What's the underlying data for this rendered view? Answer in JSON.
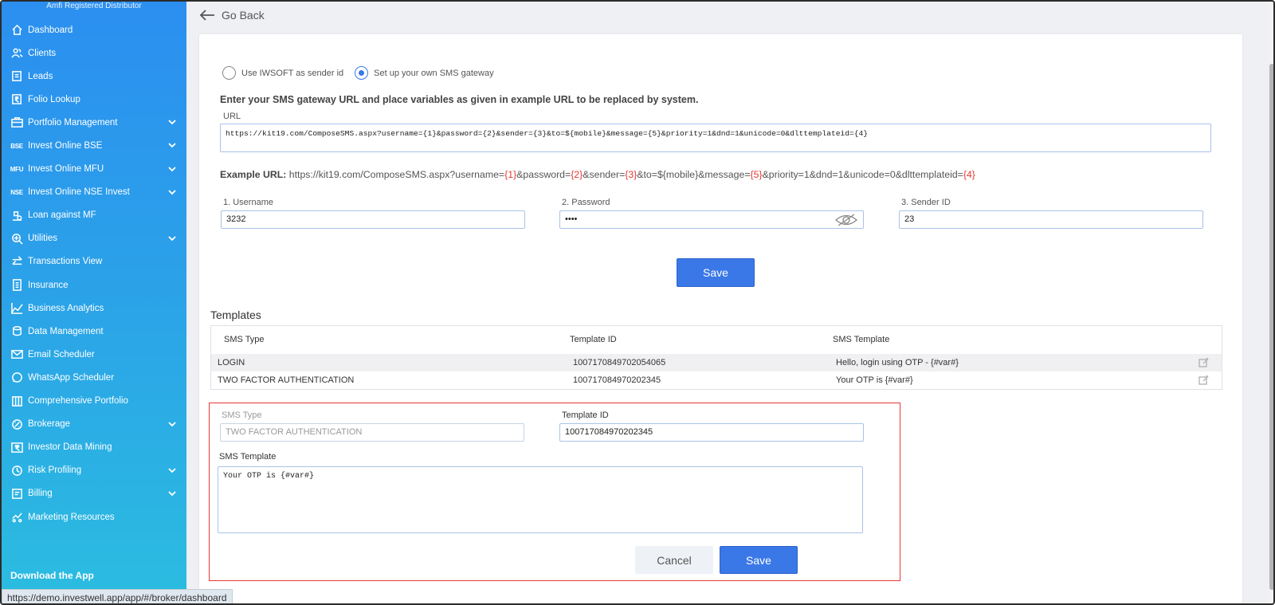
{
  "sidebar": {
    "brand": "Amfi Registered Distributor",
    "items": [
      {
        "label": "Dashboard",
        "icon": "home-icon",
        "chevron": false
      },
      {
        "label": "Clients",
        "icon": "users-icon",
        "chevron": false
      },
      {
        "label": "Leads",
        "icon": "leads-icon",
        "chevron": false
      },
      {
        "label": "Folio Lookup",
        "icon": "rupee-doc-icon",
        "chevron": false
      },
      {
        "label": "Portfolio Management",
        "icon": "briefcase-icon",
        "chevron": true
      },
      {
        "label": "Invest Online BSE",
        "icon": "bse-icon",
        "icon_text": "BSE",
        "chevron": true
      },
      {
        "label": "Invest Online MFU",
        "icon": "mfu-icon",
        "icon_text": "MFU",
        "chevron": true
      },
      {
        "label": "Invest Online NSE Invest",
        "icon": "nse-icon",
        "icon_text": "NSE",
        "chevron": true
      },
      {
        "label": "Loan against MF",
        "icon": "loan-icon",
        "chevron": false
      },
      {
        "label": "Utilities",
        "icon": "utilities-icon",
        "chevron": true
      },
      {
        "label": "Transactions View",
        "icon": "transfer-icon",
        "chevron": false
      },
      {
        "label": "Insurance",
        "icon": "insurance-icon",
        "chevron": false
      },
      {
        "label": "Business Analytics",
        "icon": "chart-icon",
        "chevron": false
      },
      {
        "label": "Data Management",
        "icon": "database-icon",
        "chevron": false
      },
      {
        "label": "Email Scheduler",
        "icon": "email-icon",
        "chevron": false
      },
      {
        "label": "WhatsApp Scheduler",
        "icon": "whatsapp-icon",
        "chevron": false
      },
      {
        "label": "Comprehensive Portfolio",
        "icon": "portfolio-icon",
        "chevron": false
      },
      {
        "label": "Brokerage",
        "icon": "brokerage-icon",
        "chevron": true
      },
      {
        "label": "Investor Data Mining",
        "icon": "rupee-icon",
        "chevron": false
      },
      {
        "label": "Risk Profiling",
        "icon": "risk-icon",
        "chevron": true
      },
      {
        "label": "Billing",
        "icon": "billing-icon",
        "chevron": true
      },
      {
        "label": "Marketing Resources",
        "icon": "marketing-icon",
        "chevron": false
      }
    ],
    "download_label": "Download the App"
  },
  "status_url": "https://demo.investwell.app/app/#/broker/dashboard",
  "header": {
    "go_back": "Go Back"
  },
  "sender": {
    "option1": "Use IWSOFT as sender id",
    "option2": "Set up your own SMS gateway",
    "selected": "option2"
  },
  "gateway": {
    "instruction": "Enter your SMS gateway URL and place variables as given in example URL to be replaced by system.",
    "url_label": "URL",
    "url_value": "https://kit19.com/ComposeSMS.aspx?username={1}&password={2}&sender={3}&to=${mobile}&message={5}&priority=1&dnd=1&unicode=0&dlttemplateid={4}",
    "example_label": "Example URL:",
    "example_parts": [
      {
        "text": " https://kit19.com/ComposeSMS.aspx?username=",
        "red": false
      },
      {
        "text": "{1}",
        "red": true
      },
      {
        "text": "&password=",
        "red": false
      },
      {
        "text": "{2}",
        "red": true
      },
      {
        "text": "&sender=",
        "red": false
      },
      {
        "text": "{3}",
        "red": true
      },
      {
        "text": "&to=${mobile}&message=",
        "red": false
      },
      {
        "text": "{5}",
        "red": true
      },
      {
        "text": "&priority=1&dnd=1&unicode=0&dlttemplateid=",
        "red": false
      },
      {
        "text": "{4}",
        "red": true
      }
    ],
    "username_label": "1. Username",
    "username_value": "3232",
    "password_label": "2. Password",
    "password_value": "••••",
    "sender_label": "3. Sender ID",
    "sender_value": "23",
    "save_label": "Save"
  },
  "templates": {
    "title": "Templates",
    "columns": [
      "SMS Type",
      "Template ID",
      "SMS Template"
    ],
    "rows": [
      {
        "type": "LOGIN",
        "id": "1007170849702054065",
        "template": "Hello, login using OTP - {#var#}"
      },
      {
        "type": "TWO FACTOR AUTHENTICATION",
        "id": "100717084970202345",
        "template": "Your OTP is {#var#}"
      }
    ]
  },
  "edit": {
    "type_label": "SMS Type",
    "type_value": "TWO FACTOR AUTHENTICATION",
    "id_label": "Template ID",
    "id_value": "100717084970202345",
    "template_label": "SMS Template",
    "template_value": "Your OTP is {#var#}",
    "cancel_label": "Cancel",
    "save_label": "Save"
  },
  "colors": {
    "primary": "#3b78e7",
    "highlight_border": "#e53935",
    "example_var": "#e53935",
    "sidebar_top": "#2b8ff0",
    "sidebar_bottom": "#2bbde0"
  }
}
